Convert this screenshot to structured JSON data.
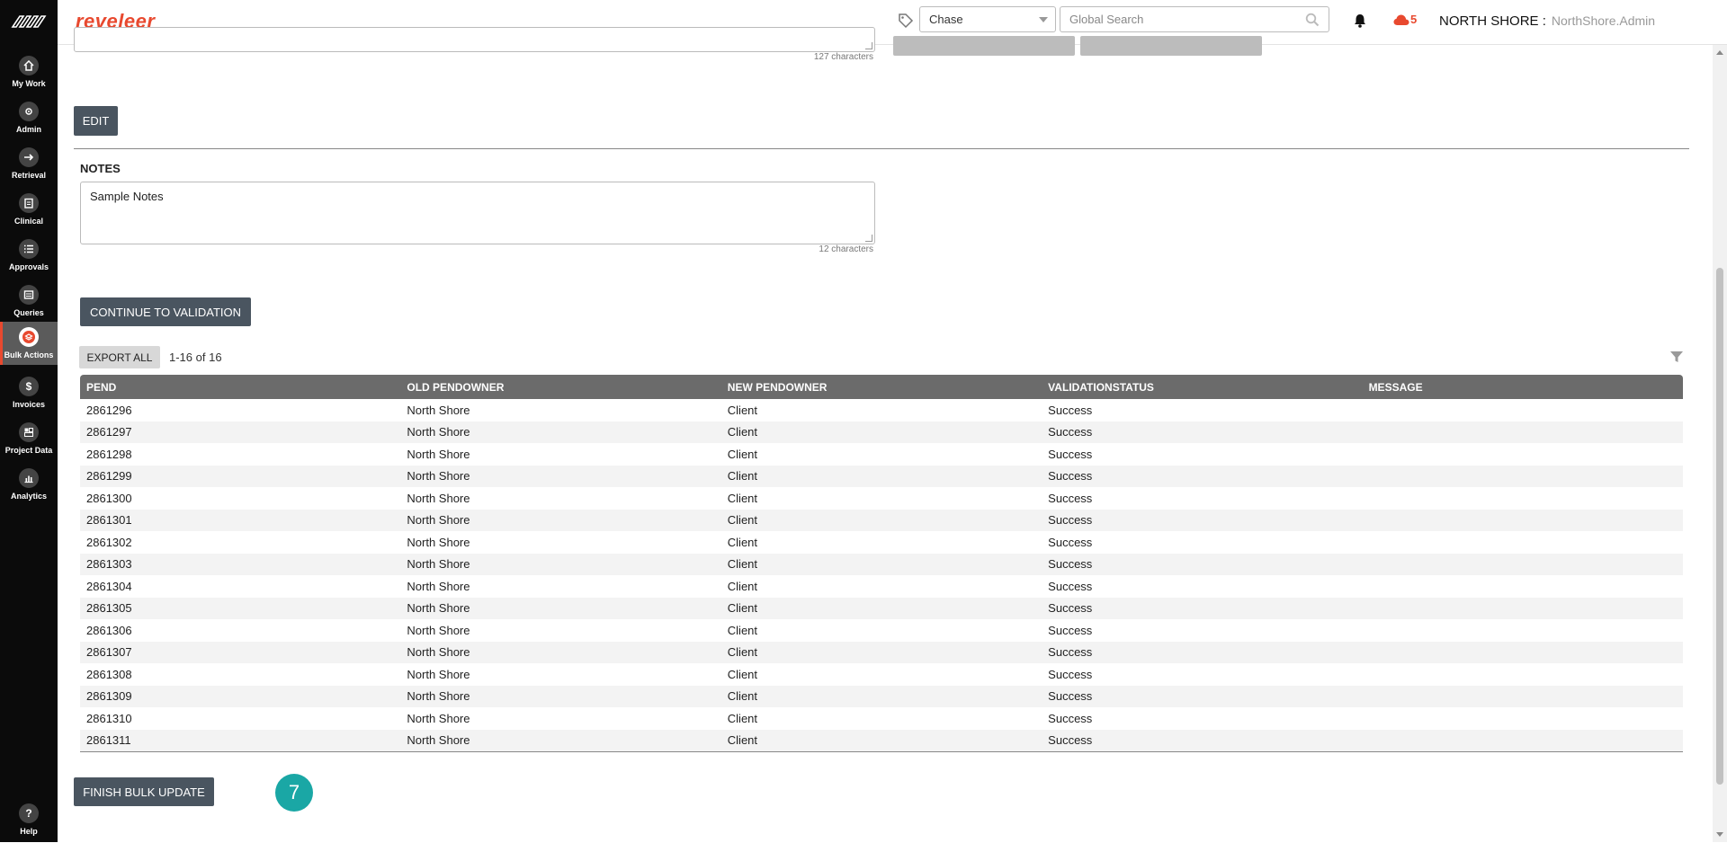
{
  "brand": "reveleer",
  "header": {
    "client_selected": "Chase",
    "search_placeholder": "Global Search",
    "alert_count": "5",
    "org_name": "NORTH SHORE :",
    "user_name": "NorthShore.Admin"
  },
  "sidebar": {
    "items": [
      {
        "label": "My Work",
        "icon": "home-icon"
      },
      {
        "label": "Admin",
        "icon": "gear-icon"
      },
      {
        "label": "Retrieval",
        "icon": "arrow-right-icon"
      },
      {
        "label": "Clinical",
        "icon": "clipboard-icon"
      },
      {
        "label": "Approvals",
        "icon": "list-icon"
      },
      {
        "label": "Queries",
        "icon": "document-icon"
      },
      {
        "label": "Bulk Actions",
        "icon": "layers-icon",
        "active": true
      },
      {
        "label": "Invoices",
        "icon": "dollar-icon"
      },
      {
        "label": "Project Data",
        "icon": "grid-icon"
      },
      {
        "label": "Analytics",
        "icon": "chart-icon"
      }
    ],
    "help_label": "Help"
  },
  "top_textarea": {
    "char_count": "127 characters"
  },
  "edit_label": "EDIT",
  "notes": {
    "label": "NOTES",
    "value": "Sample Notes",
    "char_count": "12 characters"
  },
  "continue_label": "CONTINUE TO VALIDATION",
  "export_label": "EXPORT ALL",
  "pager": "1-16  of  16",
  "table": {
    "columns": [
      "PEND",
      "OLD PENDOWNER",
      "NEW PENDOWNER",
      "VALIDATIONSTATUS",
      "MESSAGE"
    ],
    "rows": [
      [
        "2861296",
        "North Shore",
        "Client",
        "Success",
        ""
      ],
      [
        "2861297",
        "North Shore",
        "Client",
        "Success",
        ""
      ],
      [
        "2861298",
        "North Shore",
        "Client",
        "Success",
        ""
      ],
      [
        "2861299",
        "North Shore",
        "Client",
        "Success",
        ""
      ],
      [
        "2861300",
        "North Shore",
        "Client",
        "Success",
        ""
      ],
      [
        "2861301",
        "North Shore",
        "Client",
        "Success",
        ""
      ],
      [
        "2861302",
        "North Shore",
        "Client",
        "Success",
        ""
      ],
      [
        "2861303",
        "North Shore",
        "Client",
        "Success",
        ""
      ],
      [
        "2861304",
        "North Shore",
        "Client",
        "Success",
        ""
      ],
      [
        "2861305",
        "North Shore",
        "Client",
        "Success",
        ""
      ],
      [
        "2861306",
        "North Shore",
        "Client",
        "Success",
        ""
      ],
      [
        "2861307",
        "North Shore",
        "Client",
        "Success",
        ""
      ],
      [
        "2861308",
        "North Shore",
        "Client",
        "Success",
        ""
      ],
      [
        "2861309",
        "North Shore",
        "Client",
        "Success",
        ""
      ],
      [
        "2861310",
        "North Shore",
        "Client",
        "Success",
        ""
      ],
      [
        "2861311",
        "North Shore",
        "Client",
        "Success",
        ""
      ]
    ]
  },
  "finish_label": "FINISH BULK UPDATE",
  "step_badge": "7",
  "colors": {
    "accent": "#e8492f",
    "button": "#4a5560",
    "badge": "#1aa7a5",
    "table_header": "#6b6b6b"
  }
}
